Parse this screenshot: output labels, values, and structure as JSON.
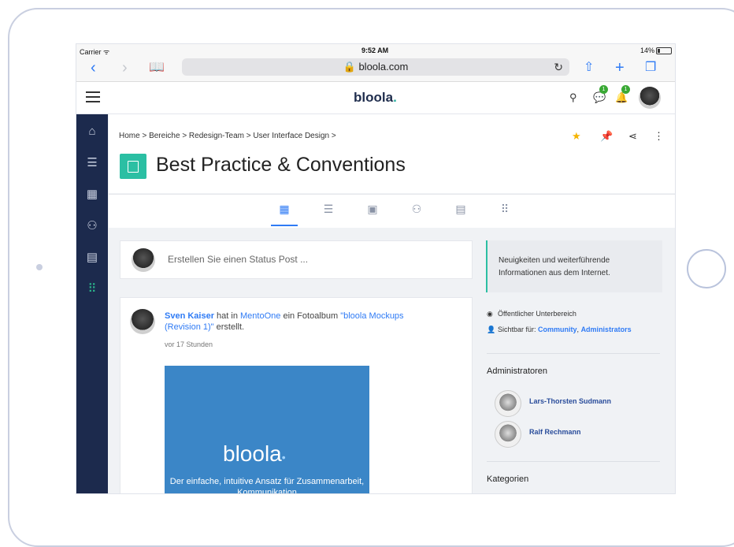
{
  "statusbar": {
    "carrier": "Carrier ᯤ",
    "time": "9:52 AM",
    "battery": "14%"
  },
  "browser": {
    "url": "🔒 bloola.com",
    "back_icon": "chevron-left-icon",
    "forward_icon": "chevron-right-icon",
    "bookmarks_icon": "book-icon",
    "reload_icon": "reload-icon",
    "share_icon": "share-icon",
    "new_tab_icon": "plus-icon",
    "tabs_icon": "tabs-icon"
  },
  "header": {
    "logo": "bloola",
    "chat_badge": "1",
    "notif_badge": "1"
  },
  "sidebar": {
    "items": [
      "home",
      "list",
      "calendar",
      "people",
      "documents",
      "apps"
    ]
  },
  "breadcrumb": "Home > Bereiche > Redesign-Team > User Interface Design >",
  "page": {
    "title": "Best Practice & Conventions"
  },
  "tabs": [
    "overview",
    "list",
    "calendar",
    "members",
    "documents",
    "apps"
  ],
  "status_post": {
    "placeholder": "Erstellen Sie einen Status Post ..."
  },
  "post": {
    "author": "Sven Kaiser",
    "text_1": " hat in ",
    "place": "MentoOne",
    "text_2": " ein Fotoalbum ",
    "album": "\"bloola Mockups (Revision 1)\"",
    "text_3": " erstellt.",
    "time": "vor 17 Stunden",
    "album_logo": "bloola",
    "album_text": "Der einfache, intuitive Ansatz für Zusammenarbeit, Kommunikation"
  },
  "right": {
    "info": "Neuigkeiten und weiterführende Informationen aus dem Internet.",
    "visibility": "Öffentlicher Unterbereich",
    "visible_for_label": "Sichtbar für:",
    "visible_for_community": "Community",
    "visible_for_admins": "Administrators",
    "admins_title": "Administratoren",
    "admins": [
      "Lars-Thorsten Sudmann",
      "Ralf Rechmann"
    ],
    "categories_title": "Kategorien"
  },
  "colors": {
    "accent": "#2f7bf5",
    "brand": "#2bbfa3",
    "sidebar": "#1c2a4d",
    "star": "#f5b400"
  }
}
